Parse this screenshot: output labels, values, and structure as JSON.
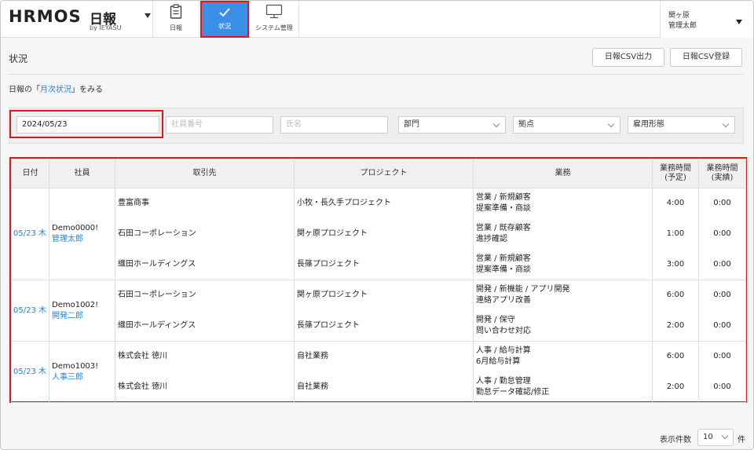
{
  "header": {
    "logo_text": "HRMOS",
    "logo_product": "日報",
    "logo_by": "by IEYASU",
    "nav": [
      {
        "label": "日報",
        "icon": "clipboard-icon"
      },
      {
        "label": "状況",
        "icon": "check-icon"
      },
      {
        "label": "システム管理",
        "icon": "monitor-icon"
      }
    ],
    "user": {
      "org": "関ヶ原",
      "name": "管理太郎"
    }
  },
  "page": {
    "title": "状況",
    "csv_export_label": "日報CSV出力",
    "csv_import_label": "日報CSV登録",
    "monthly_prefix": "日報の「",
    "monthly_link": "月次状況",
    "monthly_suffix": "」をみる"
  },
  "filters": {
    "date_value": "2024/05/23",
    "employee_no_placeholder": "社員番号",
    "name_placeholder": "氏名",
    "department": "部門",
    "site": "拠点",
    "employment_type": "雇用形態"
  },
  "table": {
    "headers": {
      "date": "日付",
      "employee": "社員",
      "client": "取引先",
      "project": "プロジェクト",
      "task": "業務",
      "planned": "業務時間\n(予定)",
      "actual": "業務時間\n(実績)"
    },
    "groups": [
      {
        "date": "05/23 木",
        "emp_id": "Demo0000!",
        "emp_name": "管理太郎",
        "rows": [
          {
            "client": "豊富商事",
            "project": "小牧・長久手プロジェクト",
            "task1": "営業 / 新規顧客",
            "task2": "提案準備・商談",
            "planned": "4:00",
            "actual": "0:00"
          },
          {
            "client": "石田コーポレーション",
            "project": "関ヶ原プロジェクト",
            "task1": "営業 / 既存顧客",
            "task2": "進捗確認",
            "planned": "1:00",
            "actual": "0:00"
          },
          {
            "client": "織田ホールディングス",
            "project": "長篠プロジェクト",
            "task1": "営業 / 新規顧客",
            "task2": "提案準備・商談",
            "planned": "3:00",
            "actual": "0:00"
          }
        ]
      },
      {
        "date": "05/23 木",
        "emp_id": "Demo1002!",
        "emp_name": "開発二郎",
        "rows": [
          {
            "client": "石田コーポレーション",
            "project": "関ヶ原プロジェクト",
            "task1": "開発 / 新機能 / アプリ開発",
            "task2": "連絡アプリ改善",
            "planned": "6:00",
            "actual": "0:00"
          },
          {
            "client": "織田ホールディングス",
            "project": "長篠プロジェクト",
            "task1": "開発 / 保守",
            "task2": "問い合わせ対応",
            "planned": "2:00",
            "actual": "0:00"
          }
        ]
      },
      {
        "date": "05/23 木",
        "emp_id": "Demo1003!",
        "emp_name": "人事三郎",
        "rows": [
          {
            "client": "株式会社 徳川",
            "project": "自社業務",
            "task1": "人事 / 給与計算",
            "task2": "6月給与計算",
            "planned": "6:00",
            "actual": "0:00"
          },
          {
            "client": "株式会社 徳川",
            "project": "自社業務",
            "task1": "人事 / 勤怠管理",
            "task2": "勤怠データ確認/修正",
            "planned": "2:00",
            "actual": "0:00"
          }
        ]
      }
    ]
  },
  "footer": {
    "per_page_label": "表示件数",
    "per_page_value": "10",
    "per_page_unit": "件"
  },
  "colors": {
    "accent": "#3b8fe6",
    "link": "#1f86e0",
    "highlight": "#e0161b"
  }
}
